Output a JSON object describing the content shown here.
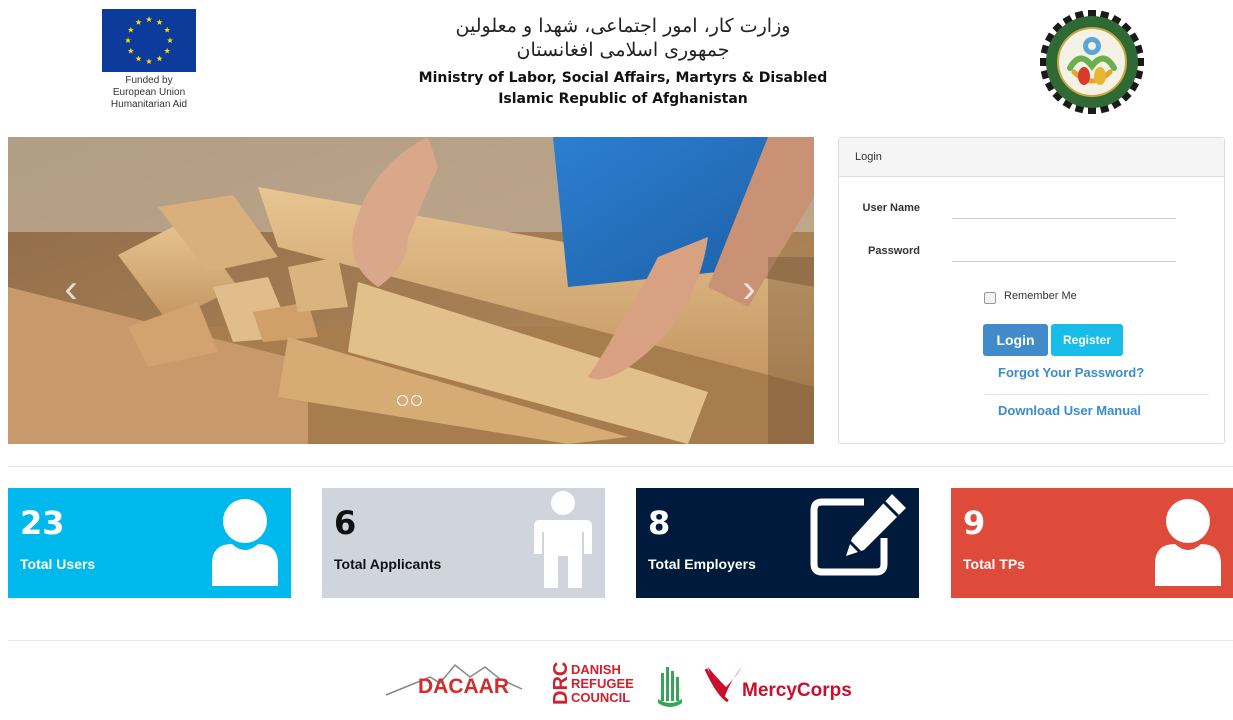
{
  "header": {
    "eu_caption": [
      "Funded by",
      "European Union",
      "Humanitarian Aid"
    ],
    "title_fa_line1": "وزارت کار، امور اجتماعی، شهدا و معلولین",
    "title_fa_line2": "جمهوری اسلامی افغانستان",
    "title_en_line1": "Ministry of Labor, Social Affairs, Martyrs & Disabled",
    "title_en_line2": "Islamic Republic of Afghanistan"
  },
  "carousel": {
    "prev_glyph": "‹",
    "next_glyph": "›",
    "slide_count": 2
  },
  "login": {
    "heading": "Login",
    "username_label": "User Name",
    "username_value": "",
    "password_label": "Password",
    "password_value": "",
    "remember_label": "Remember Me",
    "remember_checked": false,
    "login_button": "Login",
    "register_button": "Register",
    "forgot_link": "Forgot Your Password?",
    "manual_link": "Download User Manual"
  },
  "stats": [
    {
      "count": "23",
      "label": "Total Users",
      "bg": "#00b9ec",
      "fg": "#ffffff",
      "icon": "user-icon"
    },
    {
      "count": "6",
      "label": "Total Applicants",
      "bg": "#d0d5dd",
      "fg": "#111111",
      "icon": "person-standing-icon"
    },
    {
      "count": "8",
      "label": "Total Employers",
      "bg": "#001a3c",
      "fg": "#ffffff",
      "icon": "edit-icon"
    },
    {
      "count": "9",
      "label": "Total TPs",
      "bg": "#df4b3b",
      "fg": "#ffffff",
      "icon": "user-icon"
    }
  ],
  "partners": {
    "dacaar": "DACAAR",
    "drc_mark": "DRC",
    "drc_line1": "DANISH",
    "drc_line2": "REFUGEE",
    "drc_line3": "COUNCIL",
    "mercycorps": "MercyCorps"
  },
  "colors": {
    "eu_blue": "#0c3b9c",
    "eu_star": "#ffdd00",
    "login_button": "#428bca",
    "register_button": "#18bce8",
    "link": "#3a8ccf",
    "dacaar_red": "#d22d2d",
    "drc_red": "#cf202e",
    "mercy_red": "#c8102e"
  }
}
